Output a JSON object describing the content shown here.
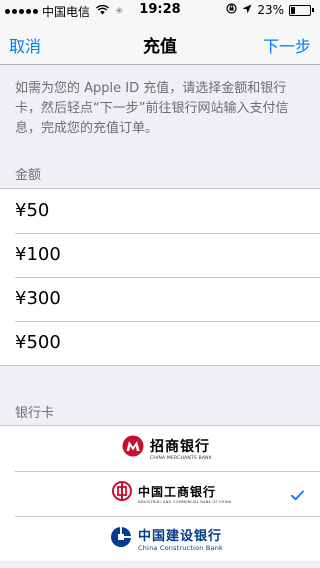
{
  "status": {
    "carrier": "中国电信",
    "time": "19:28",
    "battery": "23%",
    "battery_level": 0.23,
    "signal_bars": 5
  },
  "nav": {
    "cancel": "取消",
    "title": "充值",
    "next": "下一步"
  },
  "description": "如需为您的 Apple ID 充值，请选择金额和银行卡，然后轻点“下一步”前往银行网站输入支付信息，完成您的充值订单。",
  "amount_section": {
    "header": "金额",
    "items": [
      "¥50",
      "¥100",
      "¥300",
      "¥500"
    ]
  },
  "bank_section": {
    "header": "银行卡",
    "banks": [
      {
        "name": "招商银行",
        "english": "CHINA MERCHANTS BANK",
        "color": "#c8102e",
        "selected": false
      },
      {
        "name": "中国工商银行",
        "english": "INDUSTRIAL AND COMMERCIAL BANK OF CHINA",
        "color": "#c8102e",
        "selected": true
      },
      {
        "name": "中国建设银行",
        "english": "China Construction Bank",
        "color": "#003a8c",
        "selected": false
      }
    ]
  },
  "colors": {
    "accent": "#007aff",
    "background": "#efeff4"
  }
}
